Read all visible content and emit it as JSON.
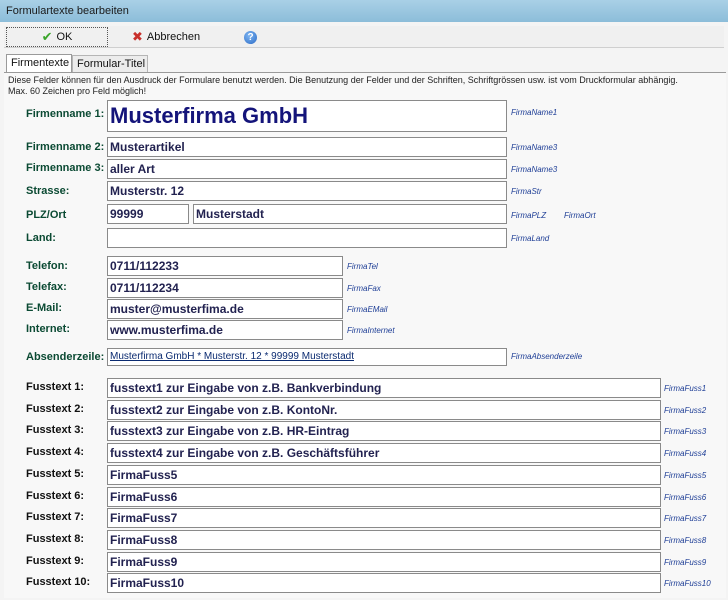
{
  "window": {
    "title": "Formulartexte bearbeiten"
  },
  "toolbar": {
    "ok_label": "OK",
    "cancel_label": "Abbrechen"
  },
  "icons": {
    "ok": "check-icon",
    "cancel": "x-icon",
    "help": "help-icon"
  },
  "tabs": [
    {
      "label": "Firmentexte"
    },
    {
      "label": "Formular-Titel"
    }
  ],
  "info": {
    "line1": "Diese Felder können für den Ausdruck der Formulare benutzt werden. Die Benutzung der Felder und der Schriften, Schriftgrössen usw. ist vom Druckformular abhängig.",
    "line2": "Max. 60 Zeichen pro Feld möglich!"
  },
  "fields": {
    "firmenname1": {
      "label": "Firmenname 1:",
      "value": "Musterfirma GmbH",
      "tag": "FirmaName1"
    },
    "firmenname2": {
      "label": "Firmenname 2:",
      "value": "Musterartikel",
      "tag": "FirmaName3"
    },
    "firmenname3": {
      "label": "Firmenname 3:",
      "value": "aller Art",
      "tag": "FirmaName3"
    },
    "strasse": {
      "label": "Strasse:",
      "value": "Musterstr. 12",
      "tag": "FirmaStr"
    },
    "plzort": {
      "label": "PLZ/Ort",
      "plz": "99999",
      "ort": "Musterstadt",
      "tag_plz": "FirmaPLZ",
      "tag_ort": "FirmaOrt"
    },
    "land": {
      "label": "Land:",
      "value": "",
      "tag": "FirmaLand"
    },
    "telefon": {
      "label": "Telefon:",
      "value": "0711/112233",
      "tag": "FirmaTel"
    },
    "telefax": {
      "label": "Telefax:",
      "value": "0711/112234",
      "tag": "FirmaFax"
    },
    "email": {
      "label": "E-Mail:",
      "value": "muster@musterfima.de",
      "tag": "FirmaEMail"
    },
    "internet": {
      "label": "Internet:",
      "value": "www.musterfima.de",
      "tag": "FirmaInternet"
    },
    "absender": {
      "label": "Absenderzeile:",
      "value": "Musterfirma GmbH * Musterstr. 12 * 99999 Musterstadt",
      "tag": "FirmaAbsenderzeile"
    }
  },
  "footers": [
    {
      "label": "Fusstext 1:",
      "value": "fusstext1 zur Eingabe von z.B. Bankverbindung",
      "tag": "FirmaFuss1"
    },
    {
      "label": "Fusstext 2:",
      "value": "fusstext2 zur Eingabe von z.B. KontoNr.",
      "tag": "FirmaFuss2"
    },
    {
      "label": "Fusstext 3:",
      "value": "fusstext3 zur Eingabe von z.B. HR-Eintrag",
      "tag": "FirmaFuss3"
    },
    {
      "label": "Fusstext 4:",
      "value": "fusstext4 zur Eingabe von z.B. Geschäftsführer",
      "tag": "FirmaFuss4"
    },
    {
      "label": "Fusstext 5:",
      "value": "FirmaFuss5",
      "tag": "FirmaFuss5"
    },
    {
      "label": "Fusstext 6:",
      "value": "FirmaFuss6",
      "tag": "FirmaFuss6"
    },
    {
      "label": "Fusstext 7:",
      "value": "FirmaFuss7",
      "tag": "FirmaFuss7"
    },
    {
      "label": "Fusstext 8:",
      "value": "FirmaFuss8",
      "tag": "FirmaFuss8"
    },
    {
      "label": "Fusstext 9:",
      "value": "FirmaFuss9",
      "tag": "FirmaFuss9"
    },
    {
      "label": "Fusstext 10:",
      "value": "FirmaFuss10",
      "tag": "FirmaFuss10"
    }
  ]
}
